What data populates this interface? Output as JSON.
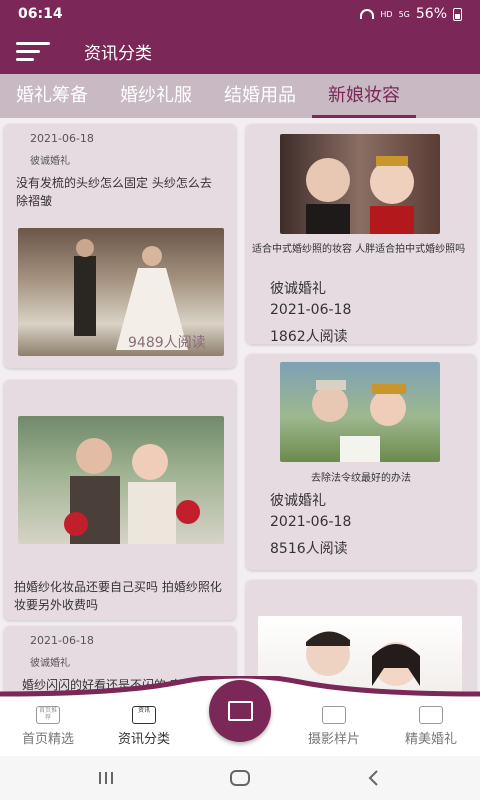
{
  "status": {
    "time": "06:14",
    "network": "HD",
    "signal_label": "5G",
    "battery": "56%"
  },
  "header": {
    "title": "资讯分类"
  },
  "tabs": [
    {
      "label": "婚礼筹备"
    },
    {
      "label": "婚纱礼服"
    },
    {
      "label": "结婚用品"
    },
    {
      "label": "新娘妆容"
    }
  ],
  "articles": [
    {
      "date": "2021-06-18",
      "author": "彼诚婚礼",
      "title": "没有发梳的头纱怎么固定 头纱怎么去除褶皱",
      "reads": "9489人阅读"
    },
    {
      "title": "适合中式婚纱照的妆容 人胖适合拍中式婚纱照吗",
      "author": "彼诚婚礼",
      "date": "2021-06-18",
      "reads": "1862人阅读"
    },
    {
      "title": "拍婚纱化妆品还要自己买吗 拍婚纱照化妆要另外收费吗"
    },
    {
      "title": "去除法令纹最好的办法",
      "author": "彼诚婚礼",
      "date": "2021-06-18",
      "reads": "8516人阅读"
    },
    {
      "date": "2021-06-18",
      "author": "彼诚婚礼",
      "title": "婚纱闪闪的好看还是不闪的 穿婚"
    }
  ],
  "bottom_nav": [
    {
      "label": "首页精选",
      "icon": "首页推荐"
    },
    {
      "label": "资讯分类",
      "icon": "资讯"
    },
    {
      "label": "摄影样片",
      "icon": "camera"
    },
    {
      "label": "精美婚礼",
      "icon": "picture"
    }
  ],
  "colors": {
    "brand": "#7b2858",
    "tab_bg": "#c9b9c3",
    "card_bg": "#e7dbe2"
  }
}
